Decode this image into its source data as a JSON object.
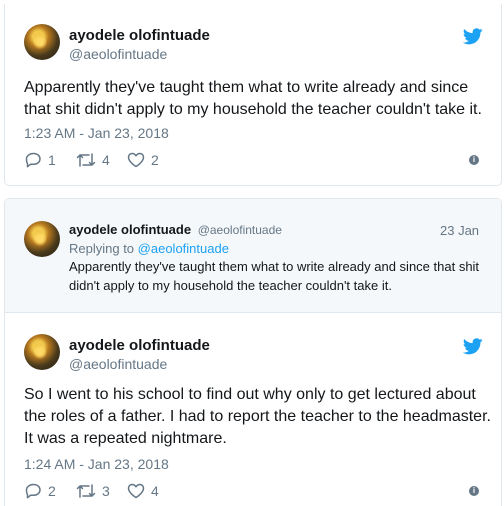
{
  "colors": {
    "accent": "#1da1f2",
    "secondary_text": "#657786",
    "border": "#e1e8ed",
    "parent_bg": "#f5f8fa"
  },
  "tweet1": {
    "author": {
      "name": "ayodele olofintuade",
      "handle": "@aeolofintuade"
    },
    "text": "Apparently they've taught them what to write already and since that shit didn't apply to my household the teacher couldn't take it.",
    "timestamp": "1:23 AM - Jan 23, 2018",
    "replies": "1",
    "retweets": "4",
    "likes": "2",
    "icons": [
      "twitter-bird-icon",
      "reply-icon",
      "retweet-icon",
      "heart-icon",
      "info-icon"
    ]
  },
  "parent_tweet": {
    "author": {
      "name": "ayodele olofintuade",
      "handle": "@aeolofintuade"
    },
    "date": "23 Jan",
    "replying_prefix": "Replying to",
    "replying_to": "@aeolofintuade",
    "text": "Apparently they've taught them what to write already and since that shit didn't apply to my household the teacher couldn't take it."
  },
  "tweet2": {
    "author": {
      "name": "ayodele olofintuade",
      "handle": "@aeolofintuade"
    },
    "text": "So I went to his school to find out why only to  get lectured about the roles of a father. I had to report the teacher to the headmaster. It was a repeated nightmare.",
    "timestamp": "1:24 AM - Jan 23, 2018",
    "replies": "2",
    "retweets": "3",
    "likes": "4"
  }
}
